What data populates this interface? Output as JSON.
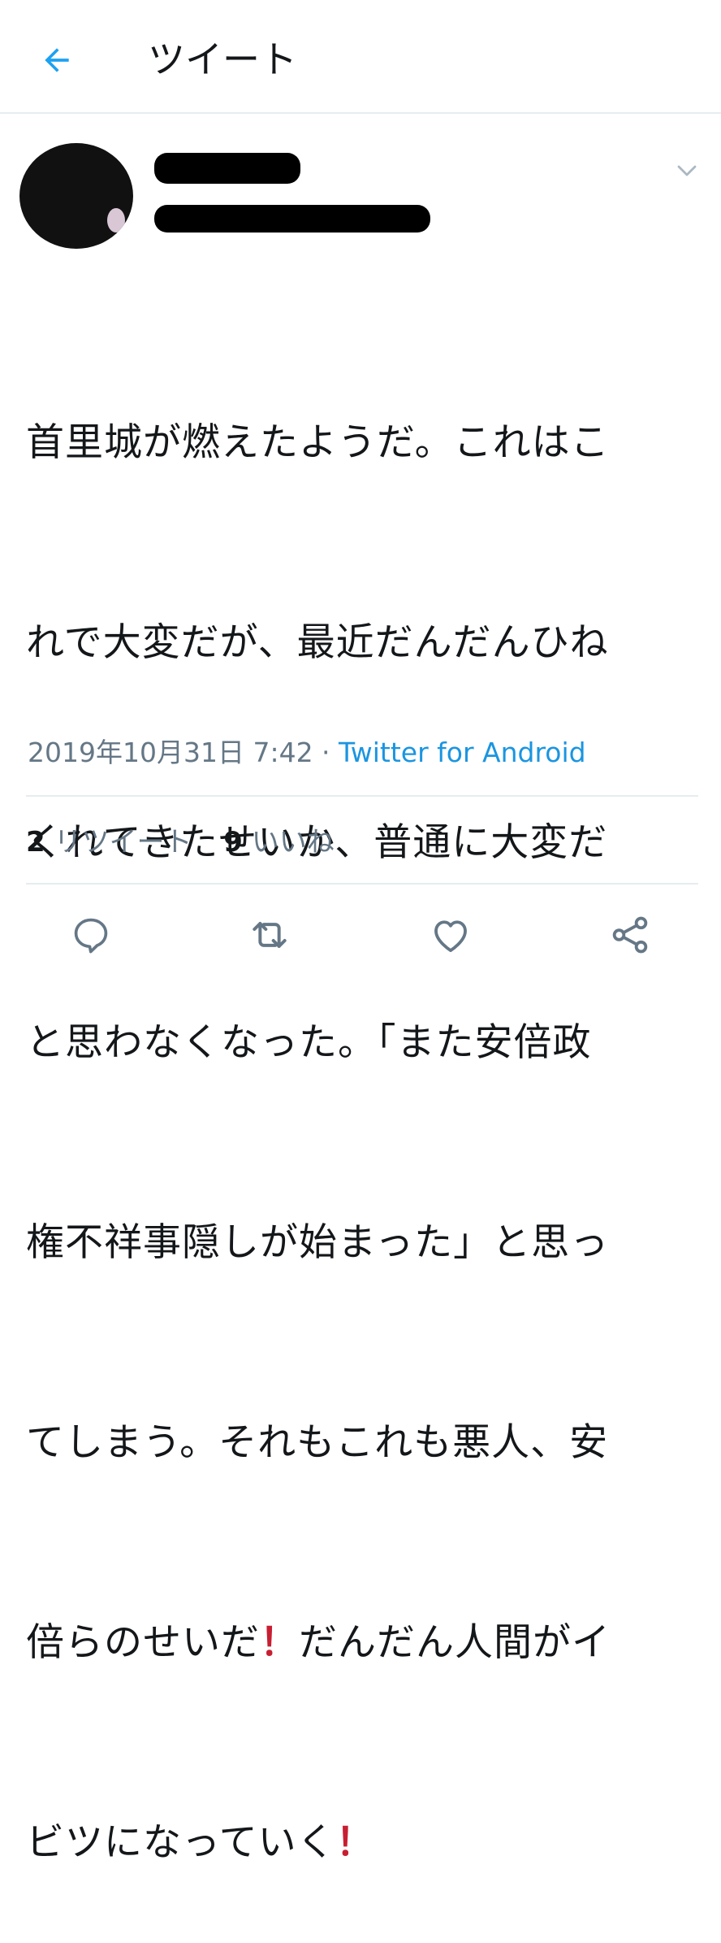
{
  "header": {
    "title": "ツイート",
    "back_icon": "arrow-left-icon",
    "accent": "#1da1f2"
  },
  "tweet": {
    "lines": [
      "首里城が燃えたようだ。これはこ",
      "れで大変だが、最近だんだんひね",
      "くれてきたせいか、普通に大変だ",
      "と思わなくなった。「また安倍政",
      "権不祥事隠しが始まった」と思っ",
      "てしまう。それもこれも悪人、安",
      "倍らのせいだ",
      "！",
      "だんだん人間がイ",
      "ビツになっていく",
      "！"
    ],
    "timestamp": "2019年10月31日 7:42",
    "separator": " · ",
    "source": "Twitter for Android"
  },
  "stats": {
    "retweets_count": "2",
    "retweets_label": "リツイート",
    "likes_count": "9",
    "likes_label": "いいね"
  },
  "actions": {
    "reply_icon": "reply-icon",
    "retweet_icon": "retweet-icon",
    "like_icon": "heart-icon",
    "share_icon": "share-icon"
  },
  "colors": {
    "text": "#14171a",
    "muted": "#657786",
    "link": "#1b95e0",
    "divider": "#e6ecf0",
    "exclamation": "#c81e32"
  }
}
